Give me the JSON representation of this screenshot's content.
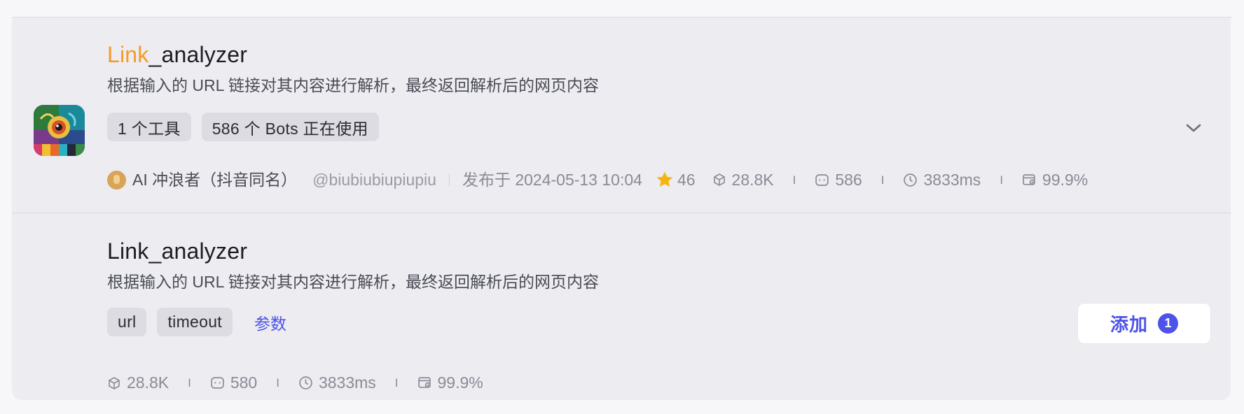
{
  "plugin": {
    "title_highlight": "Link",
    "title_rest": "_analyzer",
    "description": "根据输入的 URL 链接对其内容进行解析，最终返回解析后的网页内容",
    "tags": [
      "1 个工具",
      "586 个 Bots 正在使用"
    ],
    "author": "AI 冲浪者（抖音同名）",
    "handle": "@biubiubiupiupiu",
    "published": "发布于 2024-05-13 10:04",
    "stars": "46",
    "stats": {
      "calls": "28.8K",
      "bots": "586",
      "latency": "3833ms",
      "success_rate": "99.9%"
    },
    "stat_separator": "I"
  },
  "tool": {
    "title": "Link_analyzer",
    "description": "根据输入的 URL 链接对其内容进行解析，最终返回解析后的网页内容",
    "params": [
      "url",
      "timeout"
    ],
    "params_link": "参数",
    "stats": {
      "calls": "28.8K",
      "bots": "580",
      "latency": "3833ms",
      "success_rate": "99.9%"
    },
    "add_button": {
      "label": "添加",
      "badge": "1"
    }
  },
  "icons": {
    "plugin": "colorful-chameleon-artwork-icon",
    "calls": "cube-icon",
    "bots": "bot-face-icon",
    "latency": "clock-icon",
    "success": "success-rate-icon",
    "star": "star-icon",
    "expand": "chevron-down-icon"
  },
  "colors": {
    "accent": "#4d53e8",
    "highlight": "#f79a24",
    "star": "#f6b40e"
  }
}
